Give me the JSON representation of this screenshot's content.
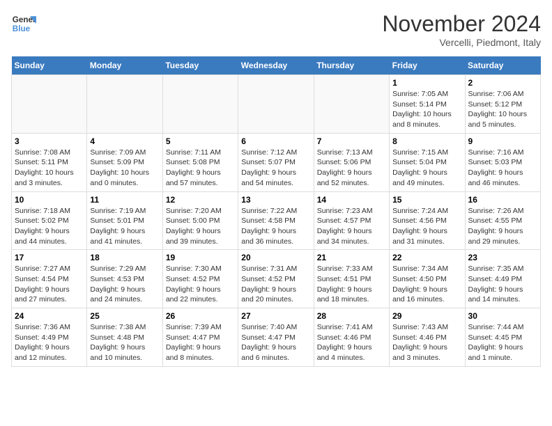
{
  "logo": {
    "line1": "General",
    "line2": "Blue"
  },
  "title": "November 2024",
  "location": "Vercelli, Piedmont, Italy",
  "weekdays": [
    "Sunday",
    "Monday",
    "Tuesday",
    "Wednesday",
    "Thursday",
    "Friday",
    "Saturday"
  ],
  "weeks": [
    [
      {
        "day": "",
        "info": ""
      },
      {
        "day": "",
        "info": ""
      },
      {
        "day": "",
        "info": ""
      },
      {
        "day": "",
        "info": ""
      },
      {
        "day": "",
        "info": ""
      },
      {
        "day": "1",
        "info": "Sunrise: 7:05 AM\nSunset: 5:14 PM\nDaylight: 10 hours\nand 8 minutes."
      },
      {
        "day": "2",
        "info": "Sunrise: 7:06 AM\nSunset: 5:12 PM\nDaylight: 10 hours\nand 5 minutes."
      }
    ],
    [
      {
        "day": "3",
        "info": "Sunrise: 7:08 AM\nSunset: 5:11 PM\nDaylight: 10 hours\nand 3 minutes."
      },
      {
        "day": "4",
        "info": "Sunrise: 7:09 AM\nSunset: 5:09 PM\nDaylight: 10 hours\nand 0 minutes."
      },
      {
        "day": "5",
        "info": "Sunrise: 7:11 AM\nSunset: 5:08 PM\nDaylight: 9 hours\nand 57 minutes."
      },
      {
        "day": "6",
        "info": "Sunrise: 7:12 AM\nSunset: 5:07 PM\nDaylight: 9 hours\nand 54 minutes."
      },
      {
        "day": "7",
        "info": "Sunrise: 7:13 AM\nSunset: 5:06 PM\nDaylight: 9 hours\nand 52 minutes."
      },
      {
        "day": "8",
        "info": "Sunrise: 7:15 AM\nSunset: 5:04 PM\nDaylight: 9 hours\nand 49 minutes."
      },
      {
        "day": "9",
        "info": "Sunrise: 7:16 AM\nSunset: 5:03 PM\nDaylight: 9 hours\nand 46 minutes."
      }
    ],
    [
      {
        "day": "10",
        "info": "Sunrise: 7:18 AM\nSunset: 5:02 PM\nDaylight: 9 hours\nand 44 minutes."
      },
      {
        "day": "11",
        "info": "Sunrise: 7:19 AM\nSunset: 5:01 PM\nDaylight: 9 hours\nand 41 minutes."
      },
      {
        "day": "12",
        "info": "Sunrise: 7:20 AM\nSunset: 5:00 PM\nDaylight: 9 hours\nand 39 minutes."
      },
      {
        "day": "13",
        "info": "Sunrise: 7:22 AM\nSunset: 4:58 PM\nDaylight: 9 hours\nand 36 minutes."
      },
      {
        "day": "14",
        "info": "Sunrise: 7:23 AM\nSunset: 4:57 PM\nDaylight: 9 hours\nand 34 minutes."
      },
      {
        "day": "15",
        "info": "Sunrise: 7:24 AM\nSunset: 4:56 PM\nDaylight: 9 hours\nand 31 minutes."
      },
      {
        "day": "16",
        "info": "Sunrise: 7:26 AM\nSunset: 4:55 PM\nDaylight: 9 hours\nand 29 minutes."
      }
    ],
    [
      {
        "day": "17",
        "info": "Sunrise: 7:27 AM\nSunset: 4:54 PM\nDaylight: 9 hours\nand 27 minutes."
      },
      {
        "day": "18",
        "info": "Sunrise: 7:29 AM\nSunset: 4:53 PM\nDaylight: 9 hours\nand 24 minutes."
      },
      {
        "day": "19",
        "info": "Sunrise: 7:30 AM\nSunset: 4:52 PM\nDaylight: 9 hours\nand 22 minutes."
      },
      {
        "day": "20",
        "info": "Sunrise: 7:31 AM\nSunset: 4:52 PM\nDaylight: 9 hours\nand 20 minutes."
      },
      {
        "day": "21",
        "info": "Sunrise: 7:33 AM\nSunset: 4:51 PM\nDaylight: 9 hours\nand 18 minutes."
      },
      {
        "day": "22",
        "info": "Sunrise: 7:34 AM\nSunset: 4:50 PM\nDaylight: 9 hours\nand 16 minutes."
      },
      {
        "day": "23",
        "info": "Sunrise: 7:35 AM\nSunset: 4:49 PM\nDaylight: 9 hours\nand 14 minutes."
      }
    ],
    [
      {
        "day": "24",
        "info": "Sunrise: 7:36 AM\nSunset: 4:49 PM\nDaylight: 9 hours\nand 12 minutes."
      },
      {
        "day": "25",
        "info": "Sunrise: 7:38 AM\nSunset: 4:48 PM\nDaylight: 9 hours\nand 10 minutes."
      },
      {
        "day": "26",
        "info": "Sunrise: 7:39 AM\nSunset: 4:47 PM\nDaylight: 9 hours\nand 8 minutes."
      },
      {
        "day": "27",
        "info": "Sunrise: 7:40 AM\nSunset: 4:47 PM\nDaylight: 9 hours\nand 6 minutes."
      },
      {
        "day": "28",
        "info": "Sunrise: 7:41 AM\nSunset: 4:46 PM\nDaylight: 9 hours\nand 4 minutes."
      },
      {
        "day": "29",
        "info": "Sunrise: 7:43 AM\nSunset: 4:46 PM\nDaylight: 9 hours\nand 3 minutes."
      },
      {
        "day": "30",
        "info": "Sunrise: 7:44 AM\nSunset: 4:45 PM\nDaylight: 9 hours\nand 1 minute."
      }
    ]
  ]
}
